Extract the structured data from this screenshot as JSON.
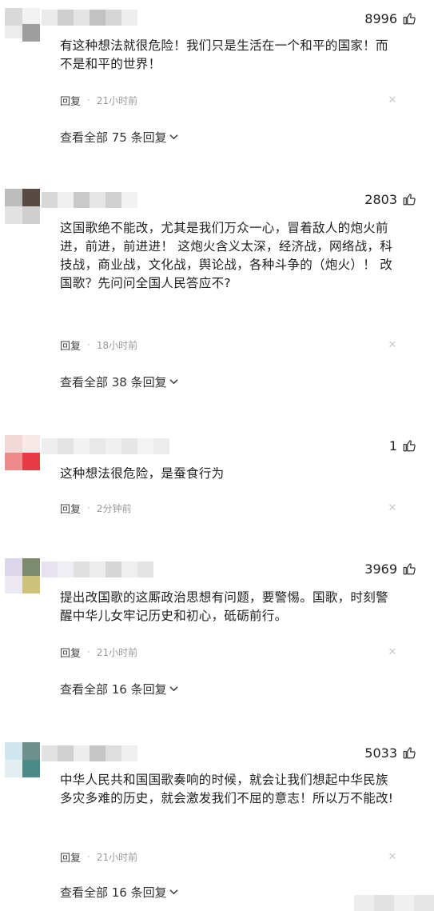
{
  "comments": [
    {
      "likes": "8996",
      "text": "有这种想法就很危险！我们只是生活在一个和平的国家！而不是和平的世界！",
      "reply_label": "回复",
      "time": "21小时前",
      "view_replies": "查看全部 75 条回复"
    },
    {
      "likes": "2803",
      "text": "这国歌绝不能改，尤其是我们万众一心，冒着敌人的炮火前进，前进，前进进！ 这炮火含义太深，经济战，网络战，科技战，商业战，文化战，舆论战，各种斗争的（炮火）！ 改国歌？先问问全国人民答应不?",
      "reply_label": "回复",
      "time": "18小时前",
      "view_replies": "查看全部 38 条回复"
    },
    {
      "likes": "1",
      "text": "这种想法很危险，是蚕食行为",
      "reply_label": "回复",
      "time": "2分钟前",
      "view_replies": ""
    },
    {
      "likes": "3969",
      "text": "提出改国歌的这厮政治思想有问题，要警惕。国歌，时刻警醒中华儿女牢记历史和初心，砥砺前行。",
      "reply_label": "回复",
      "time": "21小时前",
      "view_replies": "查看全部 16 条回复"
    },
    {
      "likes": "5033",
      "text": "中华人民共和国国歌奏响的时候，就会让我们想起中华民族多灾多难的历史，就会激发我们不屈的意志！所以万不能改!",
      "reply_label": "回复",
      "time": "21小时前",
      "view_replies": "查看全部 16 条回复"
    }
  ],
  "colors": {
    "text": "#1e1e1e",
    "meta": "#9a9a9a",
    "link": "#333333"
  },
  "icons": {
    "like": "thumbs-up-icon",
    "dismiss": "close-icon",
    "expand": "chevron-down-icon"
  }
}
